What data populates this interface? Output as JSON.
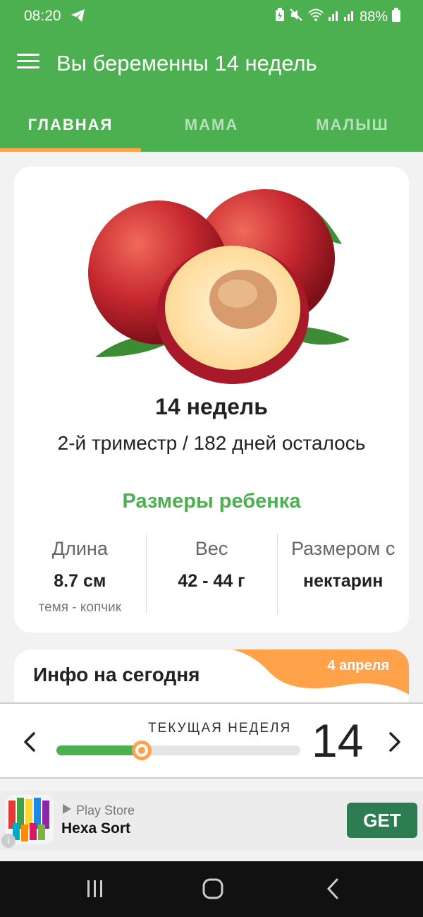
{
  "status": {
    "time": "08:20",
    "battery": "88%"
  },
  "appbar": {
    "title": "Вы беременны 14 недель"
  },
  "tabs": [
    {
      "label": "ГЛАВНАЯ",
      "active": true
    },
    {
      "label": "МАМА",
      "active": false
    },
    {
      "label": "МАЛЫШ",
      "active": false
    }
  ],
  "week_card": {
    "fruit_icon": "nectarine-image",
    "week_title": "14 недель",
    "trimester": "2-й триместр / 182 дней осталось",
    "sizes_title": "Размеры ребенка",
    "stats": [
      {
        "label": "Длина",
        "value": "8.7 см",
        "sub": "темя - копчик"
      },
      {
        "label": "Вес",
        "value": "42 - 44 г",
        "sub": ""
      },
      {
        "label": "Размером с",
        "value": "нектарин",
        "sub": ""
      }
    ]
  },
  "info_card": {
    "title": "Инфо на сегодня",
    "date": "4 апреля"
  },
  "week_selector": {
    "label": "ТЕКУЩАЯ НЕДЕЛЯ",
    "week": "14",
    "progress_fraction": 0.35
  },
  "ad": {
    "store": "Play Store",
    "name": "Hexa Sort",
    "cta": "GET"
  },
  "colors": {
    "primary": "#4caf50",
    "accent": "#ffa24a",
    "ad_button": "#2e7d52"
  }
}
